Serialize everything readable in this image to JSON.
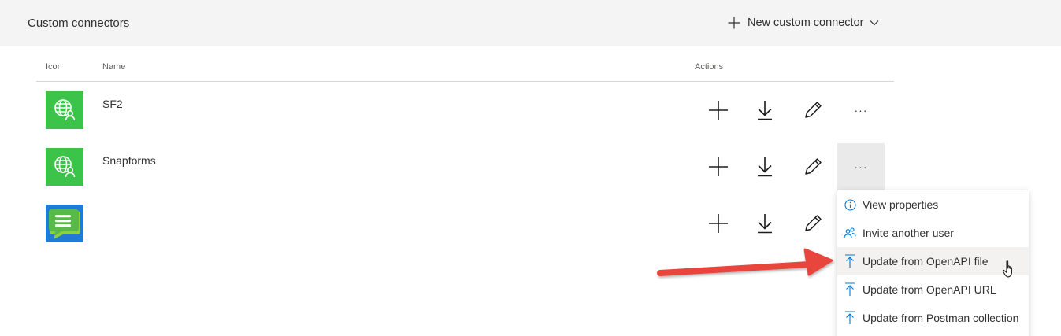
{
  "header": {
    "title": "Custom connectors",
    "new_button_label": "New custom connector"
  },
  "table": {
    "columns": {
      "icon": "Icon",
      "name": "Name",
      "actions": "Actions"
    },
    "rows": [
      {
        "name": "SF2",
        "icon": "globe-user-icon",
        "icon_bg": "#3cc34a"
      },
      {
        "name": "Snapforms",
        "icon": "globe-user-icon",
        "icon_bg": "#3cc34a"
      },
      {
        "name": "",
        "icon": "snapforms-logo-icon",
        "icon_bg": "#1f7bd6"
      }
    ],
    "row_actions": [
      "add-icon",
      "download-icon",
      "edit-pencil-icon",
      "more-ellipsis"
    ],
    "more_label": "···"
  },
  "context_menu": {
    "items": [
      {
        "label": "View properties",
        "icon": "info-icon"
      },
      {
        "label": "Invite another user",
        "icon": "people-icon"
      },
      {
        "label": "Update from OpenAPI file",
        "icon": "upload-arrow-icon"
      },
      {
        "label": "Update from OpenAPI URL",
        "icon": "upload-arrow-icon"
      },
      {
        "label": "Update from Postman collection",
        "icon": "upload-arrow-icon"
      }
    ],
    "hovered_index": 2
  },
  "colors": {
    "accent": "#0078d4",
    "annotation_arrow": "#e8453c",
    "connector_green": "#3cc34a",
    "connector_blue": "#1f7bd6"
  }
}
